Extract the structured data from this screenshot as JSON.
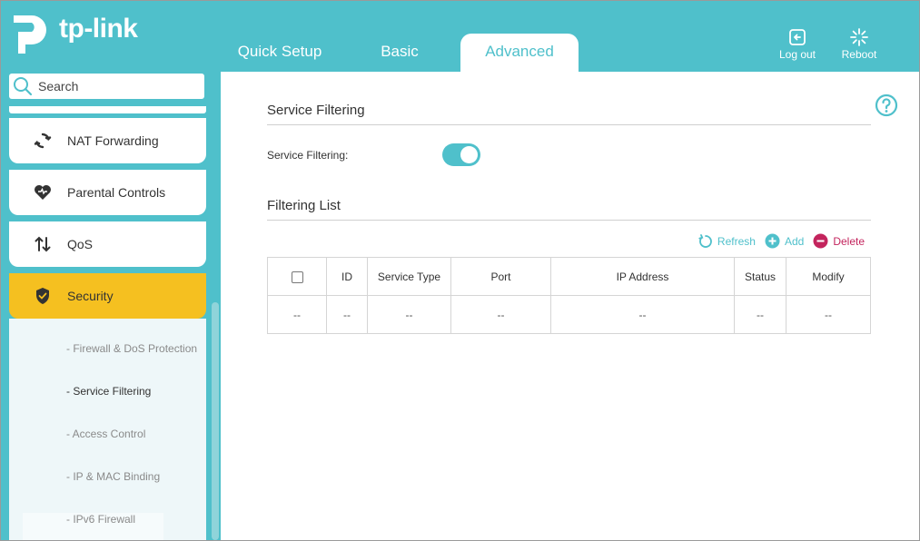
{
  "brand": {
    "name": "tp-link"
  },
  "tabs": [
    {
      "label": "Quick Setup"
    },
    {
      "label": "Basic"
    },
    {
      "label": "Advanced"
    }
  ],
  "header": {
    "logout_label": "Log out",
    "reboot_label": "Reboot"
  },
  "colors": {
    "accent": "#4fc0cb",
    "active_menu": "#f5c020",
    "delete": "#c3245d"
  },
  "sidebar": {
    "search_placeholder": "Search",
    "items": [
      {
        "label": "NAT Forwarding",
        "icon": "nat-forwarding-icon"
      },
      {
        "label": "Parental Controls",
        "icon": "heart-icon"
      },
      {
        "label": "QoS",
        "icon": "qos-arrows-icon"
      },
      {
        "label": "Security",
        "icon": "shield-icon"
      }
    ],
    "sub_items": [
      {
        "label": "- Firewall & DoS Protection"
      },
      {
        "label": "- Service Filtering"
      },
      {
        "label": "- Access Control"
      },
      {
        "label": "- IP & MAC Binding"
      },
      {
        "label": "- IPv6 Firewall"
      }
    ]
  },
  "main": {
    "section_title": "Service Filtering",
    "service_filtering_label": "Service Filtering:",
    "list_title": "Filtering List",
    "actions": {
      "refresh": "Refresh",
      "add": "Add",
      "delete": "Delete"
    },
    "table": {
      "headers": [
        "ID",
        "Service Type",
        "Port",
        "IP Address",
        "Status",
        "Modify"
      ],
      "row": [
        "--",
        "--",
        "--",
        "--",
        "--",
        "--",
        "--"
      ]
    }
  }
}
